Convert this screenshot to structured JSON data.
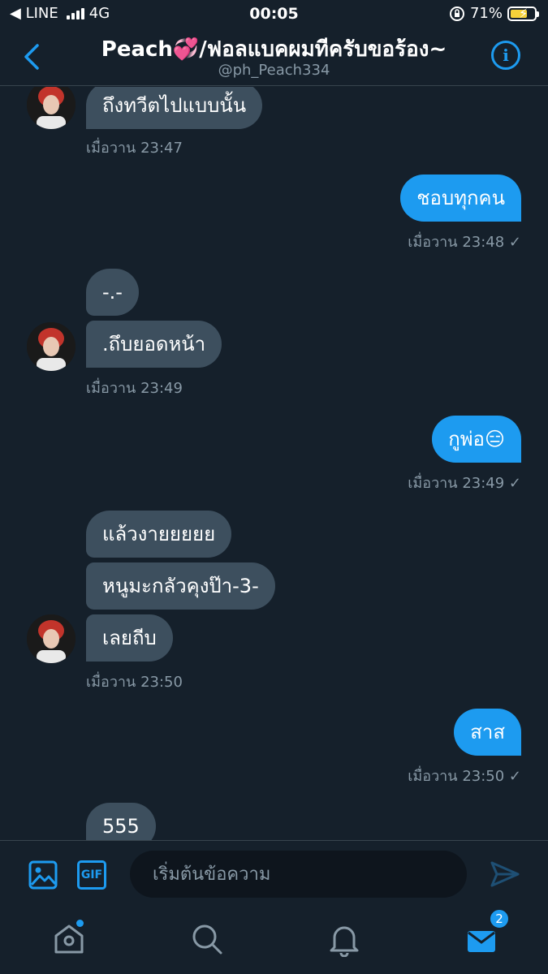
{
  "status_bar": {
    "back_app": "◀ LINE",
    "network": "4G",
    "time": "00:05",
    "battery": "71%"
  },
  "header": {
    "title": "Peach💞/ฟอลแบคผมทีครับขอร้อง~",
    "handle": "@ph_Peach334",
    "info_glyph": "i"
  },
  "messages": [
    {
      "side": "in",
      "text": "ถึงทวีตไปแบบนั้น"
    },
    {
      "meta": "เมื่อวาน 23:47"
    },
    {
      "side": "out",
      "text": "ชอบทุกคน"
    },
    {
      "meta": "เมื่อวาน 23:48 ✓"
    },
    {
      "side": "in",
      "text": "-.-"
    },
    {
      "side": "in",
      "text": ".ถึบยอดหน้า"
    },
    {
      "meta": "เมื่อวาน 23:49"
    },
    {
      "side": "out",
      "text": "กูพ่อ😑"
    },
    {
      "meta": "เมื่อวาน 23:49 ✓"
    },
    {
      "side": "in",
      "text": "แล้วงายยยยย"
    },
    {
      "side": "in",
      "text": "หนูมะกลัวคุงป๊า-3-"
    },
    {
      "side": "in",
      "text": "เลยถีบ"
    },
    {
      "meta": "เมื่อวาน 23:50"
    },
    {
      "side": "out",
      "text": "สาส"
    },
    {
      "meta": "เมื่อวาน 23:50 ✓"
    },
    {
      "side": "in",
      "text": "555"
    }
  ],
  "composer": {
    "placeholder": "เริ่มต้นข้อความ",
    "gif_label": "GIF"
  },
  "nav": {
    "messages_badge": "2"
  },
  "colors": {
    "background": "#15202b",
    "accent": "#1d9bf0",
    "incoming_bubble": "#3d4f5e",
    "meta_text": "#8899a6"
  }
}
